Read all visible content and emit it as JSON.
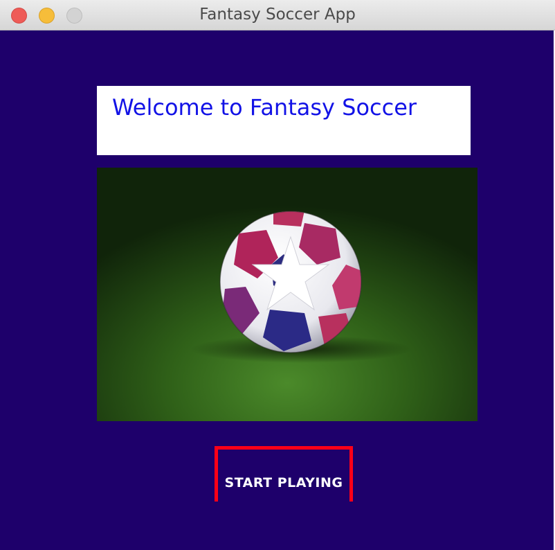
{
  "window": {
    "title": "Fantasy Soccer App",
    "controls": [
      "close-icon",
      "minimize-icon",
      "zoom-icon"
    ]
  },
  "main": {
    "welcome_text": "Welcome to Fantasy Soccer",
    "image_icon": "soccer-ball-icon",
    "start_button_label": "START PLAYING"
  },
  "colors": {
    "background": "#1e006b",
    "welcome_text": "#1212e6",
    "button_border": "#ff0018",
    "button_text": "#ffffff"
  }
}
